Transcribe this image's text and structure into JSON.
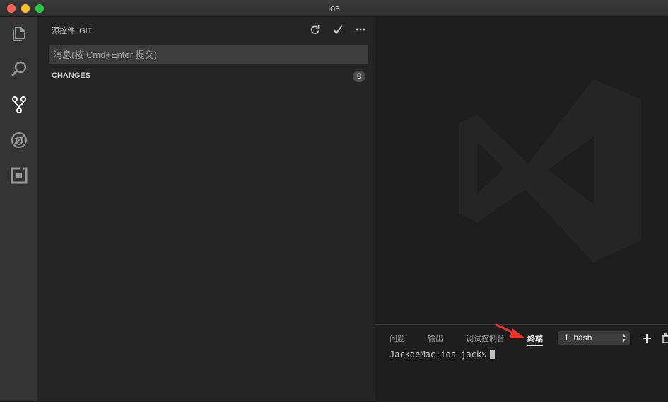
{
  "window": {
    "title": "ios"
  },
  "activity_bar": {
    "items": [
      {
        "icon": "files-icon"
      },
      {
        "icon": "search-icon"
      },
      {
        "icon": "source-control-icon"
      },
      {
        "icon": "debug-icon"
      },
      {
        "icon": "extensions-icon"
      }
    ]
  },
  "sidebar": {
    "title": "源控件: GIT",
    "actions": [
      {
        "icon": "refresh-icon"
      },
      {
        "icon": "commit-check-icon"
      },
      {
        "icon": "more-icon"
      }
    ],
    "commit_message": {
      "value": "",
      "placeholder": "消息(按 Cmd+Enter 提交)"
    },
    "changes": {
      "label": "CHANGES",
      "count": "0"
    }
  },
  "panel": {
    "tabs": [
      {
        "label": "问题",
        "active": false
      },
      {
        "label": "输出",
        "active": false
      },
      {
        "label": "调试控制台",
        "active": false
      },
      {
        "label": "终端",
        "active": true
      }
    ],
    "terminal_select": {
      "selected": "1: bash"
    },
    "actions": [
      {
        "icon": "plus-icon"
      },
      {
        "icon": "trash-icon"
      }
    ],
    "terminal": {
      "prompt": "JackdeMac:ios jack$"
    }
  },
  "colors": {
    "activity_bar": "#333333",
    "sidebar": "#252526",
    "editor": "#1e1e1e",
    "input": "#3c3c3c",
    "annotation_arrow": "#e8322b"
  }
}
